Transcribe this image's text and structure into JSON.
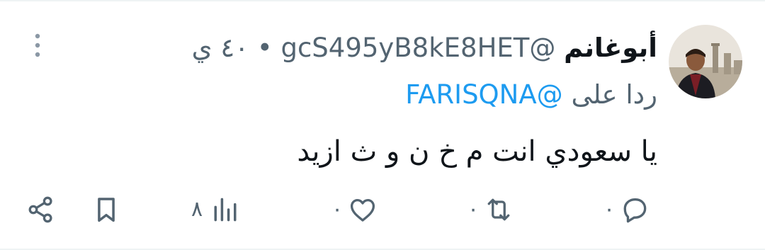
{
  "tweet": {
    "author_name": "أبوغانم",
    "handle": "@gcS495yB8kE8HET",
    "separator": "•",
    "time": "٤٠ ي",
    "reply_prefix": "ردا على",
    "reply_mention": "@FARISQNA",
    "text": "يا سعودي انت م خ ن و ث ازيد"
  },
  "actions": {
    "reply_count": "٠",
    "retweet_count": "٠",
    "like_count": "٠",
    "views_count": "٨"
  },
  "icons": {
    "more": "more-vertical-icon",
    "reply": "reply-bubble-icon",
    "retweet": "retweet-icon",
    "like": "heart-icon",
    "views": "views-bar-chart-icon",
    "bookmark": "bookmark-icon",
    "share": "share-icon"
  },
  "colors": {
    "text": "#0f1419",
    "muted": "#536471",
    "link": "#1d9bf0"
  }
}
